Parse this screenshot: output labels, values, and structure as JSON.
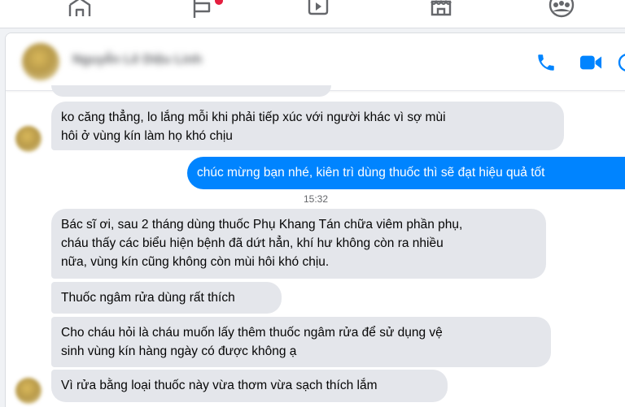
{
  "nav": {
    "icons": [
      "home-icon",
      "flag-icon",
      "video-icon",
      "marketplace-icon",
      "groups-icon"
    ],
    "accent": "#1b74e4"
  },
  "header": {
    "contact_name": "Nguyễn Lê Diệu Linh",
    "actions": [
      "phone-icon",
      "video-call-icon"
    ]
  },
  "messages": [
    {
      "side": "in",
      "text_lines": [
        "ko căng thẳng, lo lắng mỗi khi phải tiếp xúc với người khác vì sợ mùi",
        "hôi ở vùng kín làm họ khó chịu"
      ]
    },
    {
      "side": "out",
      "text_lines": [
        "chúc mừng bạn nhé, kiên trì dùng thuốc thì sẽ đạt hiệu quả tốt"
      ]
    },
    {
      "side": "in",
      "text_lines": [
        "Bác sĩ ơi, sau 2 tháng dùng thuốc Phụ Khang Tán chữa viêm phần phụ,",
        "cháu thấy các biểu hiện bệnh đã dứt hẳn, khí hư không còn ra nhiều",
        "nữa, vùng kín cũng không còn mùi hôi khó chịu."
      ]
    },
    {
      "side": "in",
      "text_lines": [
        "Thuốc ngâm rửa dùng rất thích"
      ]
    },
    {
      "side": "in",
      "text_lines": [
        "Cho cháu hỏi là cháu muốn lấy thêm thuốc ngâm rửa để sử dụng vệ",
        "sinh vùng kín hàng ngày có được không ạ"
      ]
    },
    {
      "side": "in",
      "text_lines": [
        "Vì rửa bằng loại thuốc này vừa thơm vừa sạch thích lắm"
      ]
    }
  ],
  "timestamp": "15:32",
  "colors": {
    "outgoing_bubble": "#0084ff",
    "incoming_bubble": "#e4e6eb",
    "icon_blue": "#0084ff"
  }
}
